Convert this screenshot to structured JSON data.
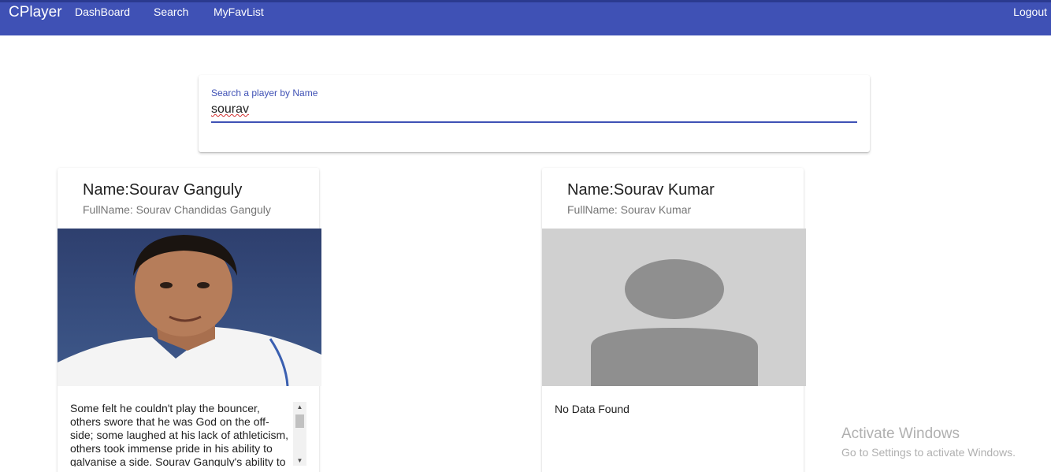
{
  "toolbar": {
    "brand": "CPlayer",
    "nav": {
      "dashboard": "DashBoard",
      "search": "Search",
      "fav": "MyFavList"
    },
    "logout": "Logout",
    "color": "#3f51b5"
  },
  "search": {
    "label": "Search a player by Name",
    "value": "sourav"
  },
  "players": [
    {
      "title": "Name:Sourav Ganguly",
      "subtitle": "FullName: Sourav Chandidas Ganguly",
      "image": "player-photo",
      "description": "Some felt he couldn't play the bouncer, others swore that he was God on the off-side; some laughed at his lack of athleticism, others took immense pride in his ability to galvanise a side. Sourav Ganguly's ability to polarise opinion"
    },
    {
      "title": "Name:Sourav Kumar",
      "subtitle": "FullName: Sourav Kumar",
      "image": "placeholder-avatar-icon",
      "description": "No Data Found"
    }
  ],
  "watermark": {
    "title": "Activate Windows",
    "subtitle": "Go to Settings to activate Windows."
  }
}
